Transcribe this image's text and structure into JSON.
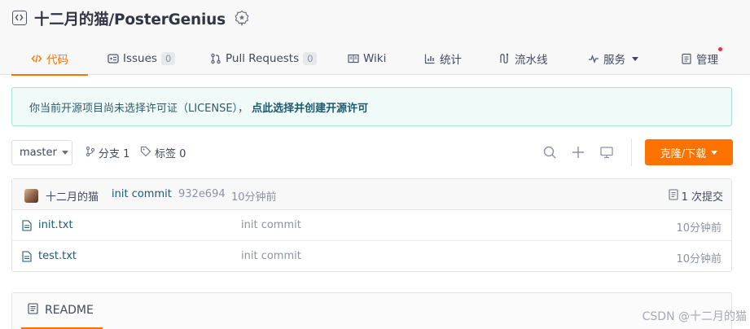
{
  "repo": {
    "title": "十二月的猫/PosterGenius",
    "icon": "code-repo-icon",
    "badge_icon": "award-badge-icon"
  },
  "tabs": [
    {
      "label": "代码",
      "icon": "code-icon",
      "active": true
    },
    {
      "label": "Issues",
      "icon": "issues-icon",
      "count": "0"
    },
    {
      "label": "Pull Requests",
      "icon": "pull-request-icon",
      "count": "0"
    },
    {
      "label": "Wiki",
      "icon": "book-icon"
    },
    {
      "label": "统计",
      "icon": "bar-chart-icon"
    },
    {
      "label": "流水线",
      "icon": "pipeline-icon"
    },
    {
      "label": "服务",
      "icon": "pulse-icon"
    },
    {
      "label": "管理",
      "icon": "clipboard-icon"
    }
  ],
  "notice": {
    "text": "你当前开源项目尚未选择许可证（LICENSE），",
    "link": "点此选择并创建开源许可"
  },
  "toolbar": {
    "branch": "master",
    "branches": "分支 1",
    "tags": "标签 0",
    "clone_label": "克隆/下载"
  },
  "last_commit": {
    "author": "十二月的猫",
    "message": "init commit",
    "sha": "932e694",
    "time": "10分钟前",
    "commit_count": "1 次提交"
  },
  "files": [
    {
      "name": "init.txt",
      "message": "init commit",
      "time": "10分钟前"
    },
    {
      "name": "test.txt",
      "message": "init commit",
      "time": "10分钟前"
    }
  ],
  "readme": {
    "label": "README"
  },
  "watermark": "CSDN @十二月的猫",
  "colors": {
    "accent": "#fe7300",
    "link": "#1b5a6d",
    "notice_bg": "#f0fbf9"
  }
}
